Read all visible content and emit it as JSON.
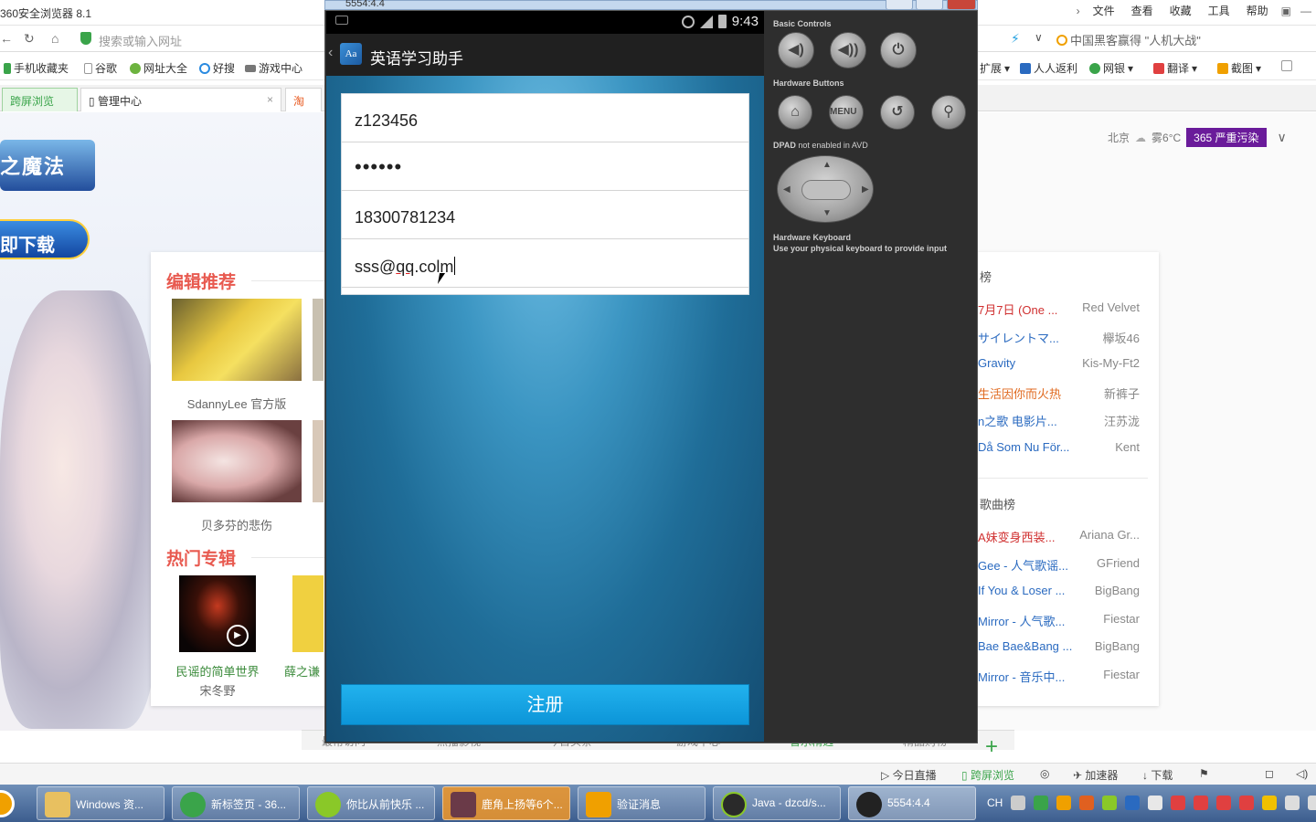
{
  "browser": {
    "title": "360安全浏览器 8.1",
    "menu": [
      "文件",
      "查看",
      "收藏",
      "工具",
      "帮助"
    ],
    "url_placeholder": "搜索或输入网址",
    "search_text": "中国黑客赢得 \"人机大战\"",
    "bookmarks": [
      "手机收藏夹",
      "谷歌",
      "网址大全",
      "好搜",
      "游戏中心"
    ],
    "bookmarks_right": [
      "扩展",
      "人人返利",
      "网银",
      "翻译",
      "截图"
    ],
    "tabs": [
      "跨屏浏览",
      "管理中心"
    ]
  },
  "webpage": {
    "game_logo": "之魔法",
    "download_btn": "即下载",
    "weather": {
      "city": "北京",
      "condition": "雾6°C",
      "aqi": "365 严重污染"
    },
    "editor_title": "编辑推荐",
    "editor_items": [
      {
        "caption": "SdannyLee 官方版"
      },
      {
        "caption": "贝多芬的悲伤"
      }
    ],
    "hot_title": "热门专辑",
    "hot_items": [
      {
        "title": "民谣的简单世界",
        "artist": "宋冬野"
      },
      {
        "title": "薛之谦"
      }
    ],
    "chart1_title": "榜",
    "chart1": [
      {
        "song": "7月7日 (One ...",
        "artist": "Red Velvet",
        "style": "red"
      },
      {
        "song": "サイレントマ...",
        "artist": "欅坂46",
        "style": ""
      },
      {
        "song": "Gravity",
        "artist": "Kis-My-Ft2",
        "style": ""
      },
      {
        "song": "生活因你而火热",
        "artist": "新裤子",
        "style": "orange"
      },
      {
        "song": "n之歌 电影片...",
        "artist": "汪苏泷",
        "style": ""
      },
      {
        "song": "Då Som Nu För...",
        "artist": "Kent",
        "style": ""
      }
    ],
    "chart2_title": "歌曲榜",
    "chart2": [
      {
        "song": "A妹变身西装...",
        "artist": "Ariana Gr...",
        "style": "red"
      },
      {
        "song": "Gee - 人气歌谣...",
        "artist": "GFriend",
        "style": ""
      },
      {
        "song": "If You & Loser ...",
        "artist": "BigBang",
        "style": ""
      },
      {
        "song": "Mirror - 人气歌...",
        "artist": "Fiestar",
        "style": ""
      },
      {
        "song": "Bae Bae&Bang ...",
        "artist": "BigBang",
        "style": ""
      },
      {
        "song": "Mirror - 音乐中...",
        "artist": "Fiestar",
        "style": ""
      }
    ],
    "bottom_tabs": [
      "最常访问",
      "热播影视",
      "今日头条",
      "游戏中心",
      "音乐精选",
      "精品购物"
    ]
  },
  "statusbar": [
    "今日直播",
    "跨屏浏览",
    "加速器",
    "下载"
  ],
  "taskbar": {
    "tasks": [
      "Windows 资...",
      "新标签页 - 36...",
      "你比从前快乐 ...",
      "鹿角上扬等6个...",
      "验证消息",
      "Java - dzcd/s...",
      "5554:4.4"
    ],
    "tray_lang": "CH"
  },
  "emulator": {
    "window_title": "5554:4.4",
    "clock": "9:43",
    "app_title": "英语学习助手",
    "app_icon_text": "Aa",
    "fields": {
      "username": "z123456",
      "password": "••••••",
      "phone": "18300781234",
      "email_prefix": "sss@",
      "email_domain1": "qq",
      "email_suffix": ".colm"
    },
    "register_label": "注册",
    "controls": {
      "basic": "Basic Controls",
      "hardware": "Hardware Buttons",
      "dpad_bold": "DPAD",
      "dpad_rest": " not enabled in AVD",
      "kbd_title": "Hardware Keyboard",
      "kbd_note": "Use your physical keyboard to provide input",
      "menu_label": "MENU"
    }
  }
}
